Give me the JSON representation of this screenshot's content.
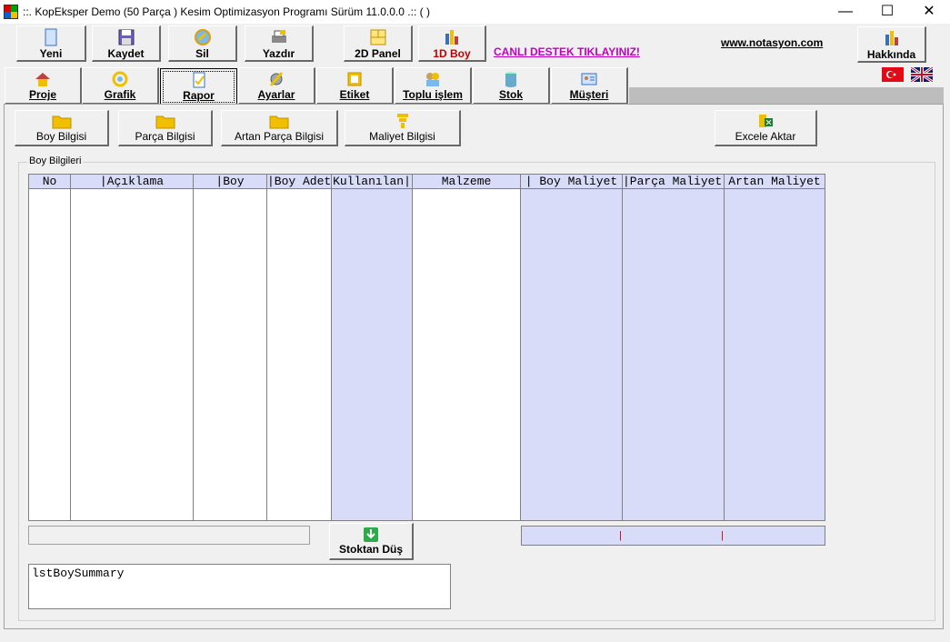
{
  "window": {
    "title": "::. KopEksper Demo (50 Parça ) Kesim Optimizasyon Programı Sürüm 11.0.0.0 .::  ( )",
    "minimize": "—",
    "maximize": "☐",
    "close": "✕"
  },
  "toolbar": {
    "new": "Yeni",
    "save": "Kaydet",
    "delete": "Sil",
    "print": "Yazdır",
    "panel2d": "2D Panel",
    "boy1d": "1D Boy",
    "support_link": "CANLI DESTEK TIKLAYINIZ!",
    "website": "www.notasyon.com",
    "about": "Hakkında"
  },
  "tabs": [
    {
      "label": "Proje",
      "icon": "house-icon"
    },
    {
      "label": "Grafik",
      "icon": "ring-icon"
    },
    {
      "label": "Rapor",
      "icon": "report-icon"
    },
    {
      "label": "Ayarlar",
      "icon": "settings-icon"
    },
    {
      "label": "Etiket",
      "icon": "label-icon"
    },
    {
      "label": "Toplu işlem",
      "icon": "batch-icon"
    },
    {
      "label": "Stok",
      "icon": "stock-icon"
    },
    {
      "label": "Müşteri",
      "icon": "customer-icon"
    }
  ],
  "active_tab": "Rapor",
  "sub_buttons": {
    "boy": "Boy Bilgisi",
    "parca": "Parça Bilgisi",
    "artan": "Artan Parça Bilgisi",
    "maliyet": "Maliyet Bilgisi",
    "excel": "Excele Aktar"
  },
  "group_title": "Boy Bilgileri",
  "table": {
    "columns": [
      "No",
      "|Açıklama",
      "|Boy",
      "|Boy Adet|",
      "Kullanılan|",
      "Malzeme",
      "| Boy Maliyet",
      "|Parça Maliyet|",
      "Artan Maliyet"
    ]
  },
  "totals_marks": [
    "|",
    "|"
  ],
  "stock_button": "Stoktan Düş",
  "summary_text": "lstBoySummary",
  "colors": {
    "grid_blue": "#d8dcf8",
    "link_magenta": "#c000c0",
    "boy1d_red": "#c00000"
  }
}
